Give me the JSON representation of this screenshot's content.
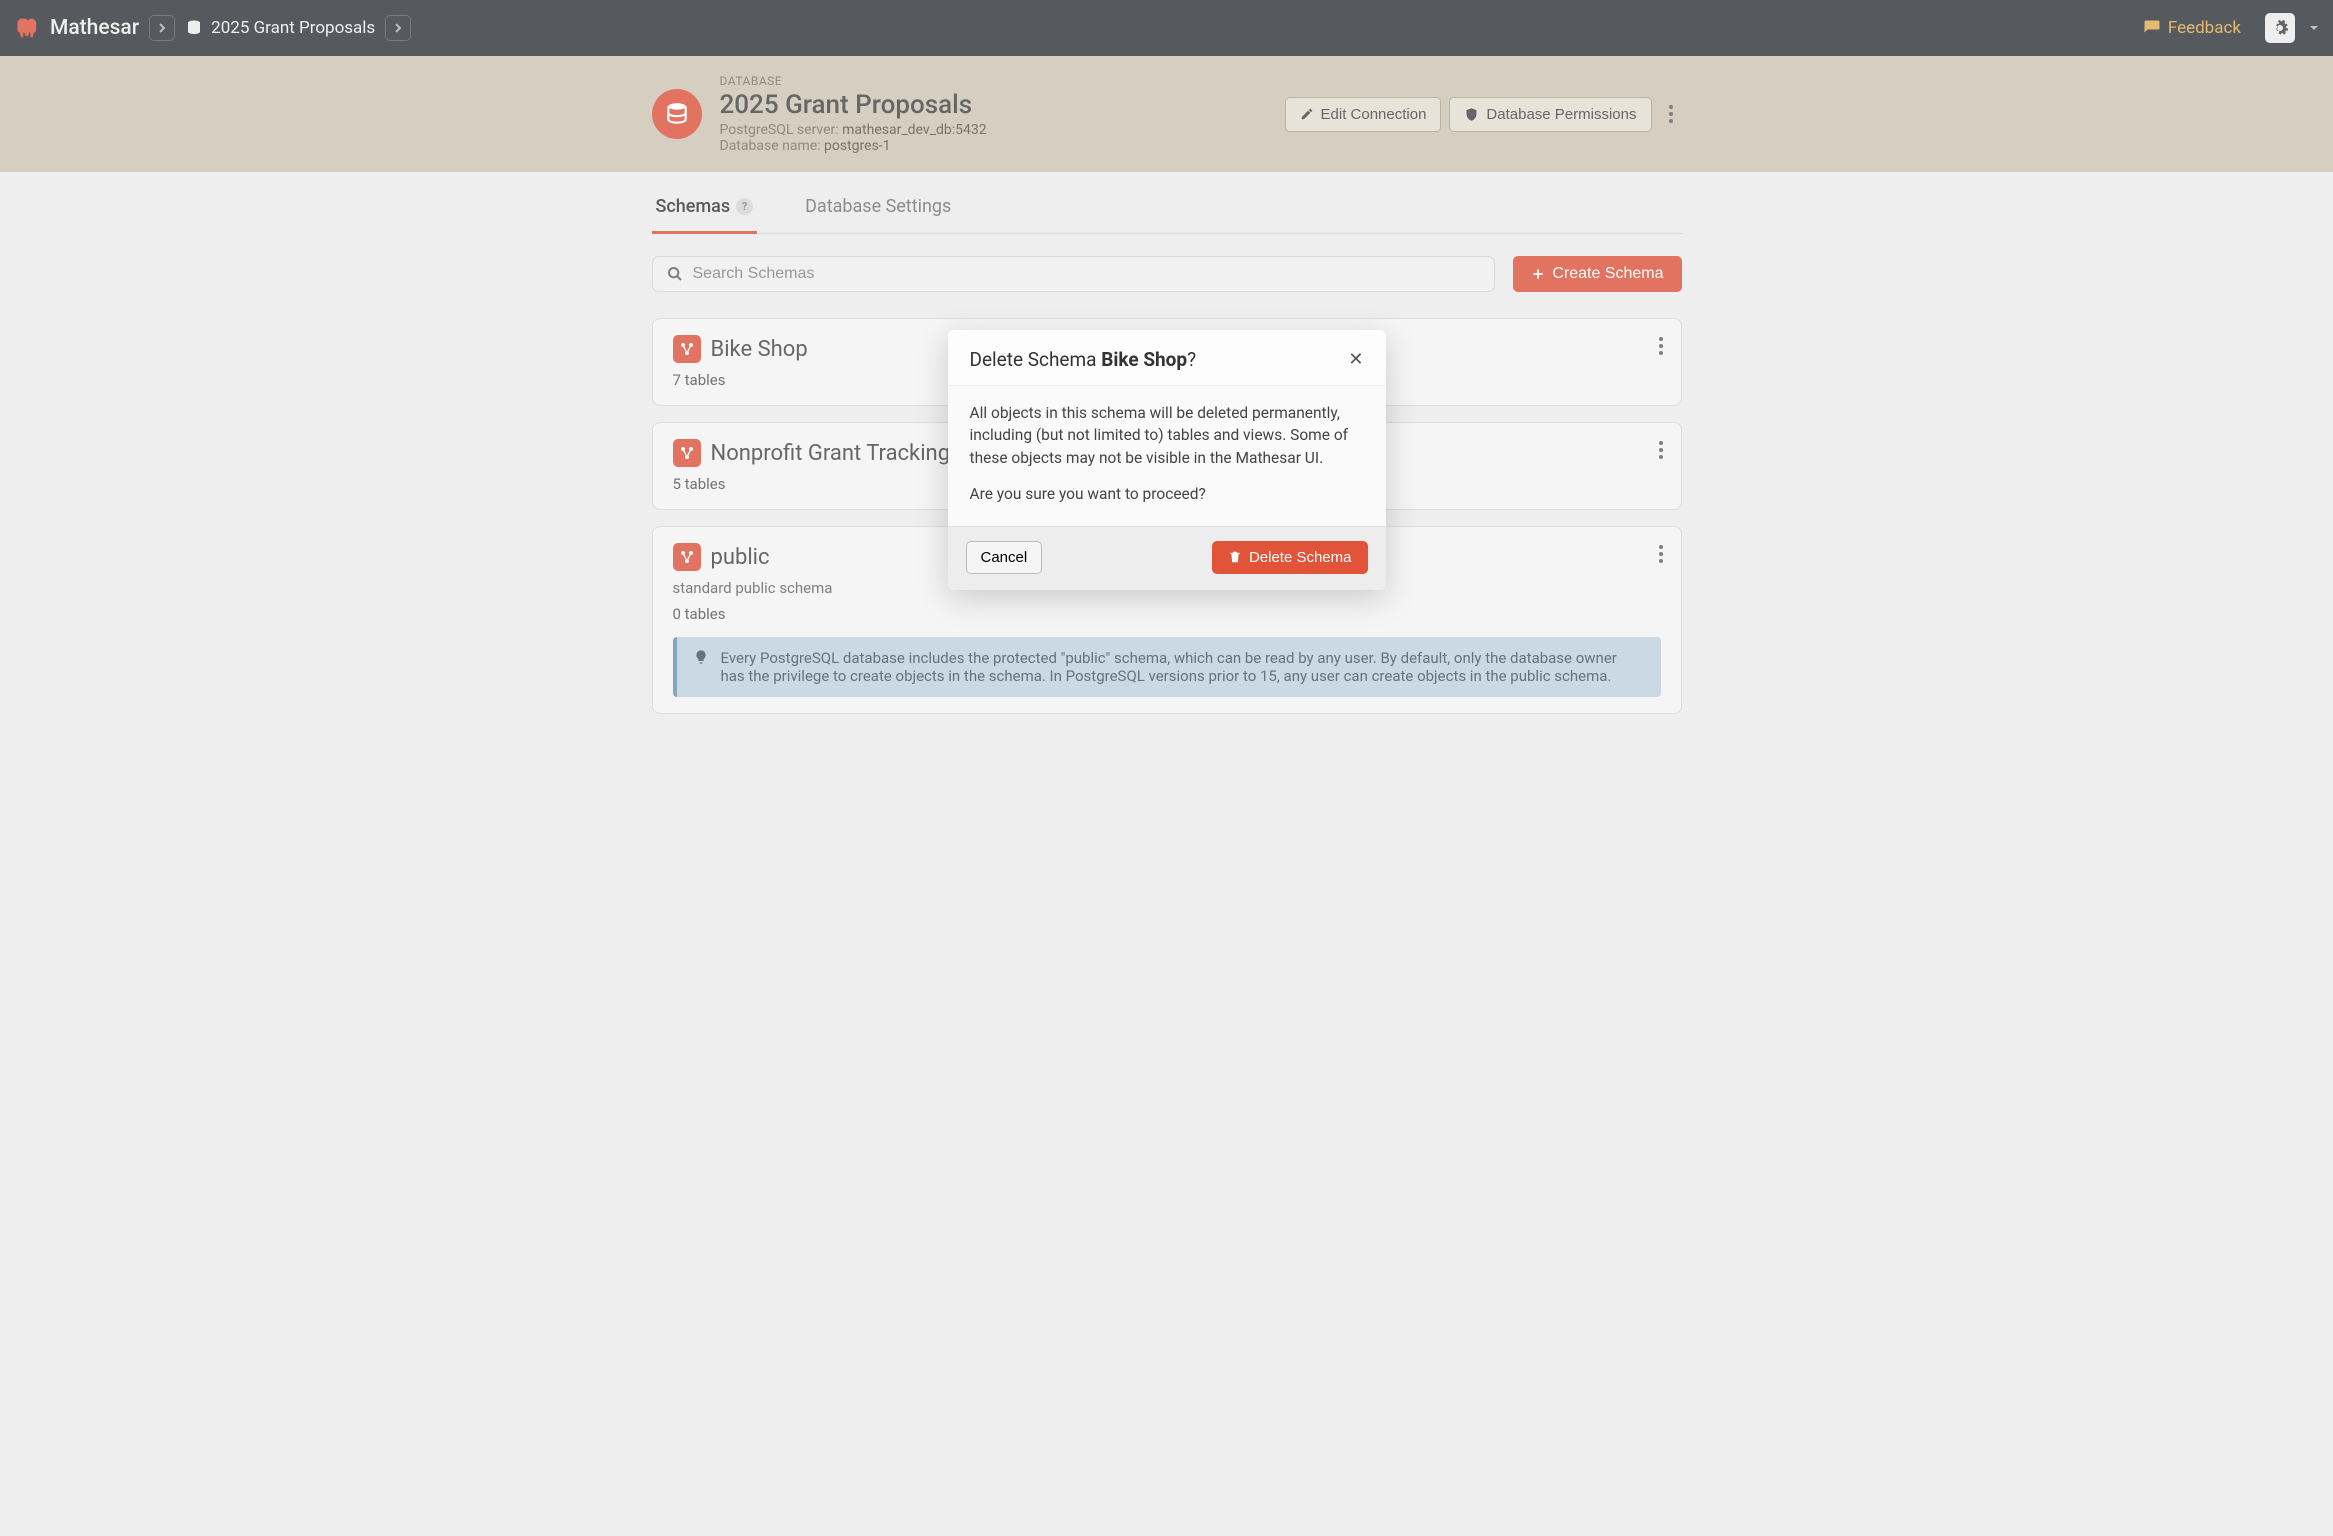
{
  "nav": {
    "app_name": "Mathesar",
    "breadcrumb_label": "2025 Grant Proposals",
    "feedback_label": "Feedback"
  },
  "header": {
    "caption": "DATABASE",
    "title": "2025 Grant Proposals",
    "server_label": "PostgreSQL server:",
    "server_value": "mathesar_dev_db:5432",
    "dbname_label": "Database name:",
    "dbname_value": "postgres-1",
    "edit_connection": "Edit Connection",
    "db_permissions": "Database Permissions"
  },
  "tabs": {
    "schemas": "Schemas",
    "schemas_badge": "?",
    "settings": "Database Settings"
  },
  "search": {
    "placeholder": "Search Schemas",
    "create_label": "Create Schema"
  },
  "schemas": [
    {
      "name": "Bike Shop",
      "count": "7 tables"
    },
    {
      "name": "Nonprofit Grant Tracking",
      "count": "5 tables"
    },
    {
      "name": "public",
      "desc": "standard public schema",
      "count": "0 tables",
      "info": "Every PostgreSQL database includes the protected \"public\" schema, which can be read by any user. By default, only the database owner has the privilege to create objects in the schema. In PostgreSQL versions prior to 15, any user can create objects in the public schema."
    }
  ],
  "modal": {
    "title_prefix": "Delete Schema ",
    "title_target": "Bike Shop",
    "title_suffix": "?",
    "body1": "All objects in this schema will be deleted permanently, including (but not limited to) tables and views. Some of these objects may not be visible in the Mathesar UI.",
    "body2": "Are you sure you want to proceed?",
    "cancel": "Cancel",
    "delete": "Delete Schema"
  }
}
